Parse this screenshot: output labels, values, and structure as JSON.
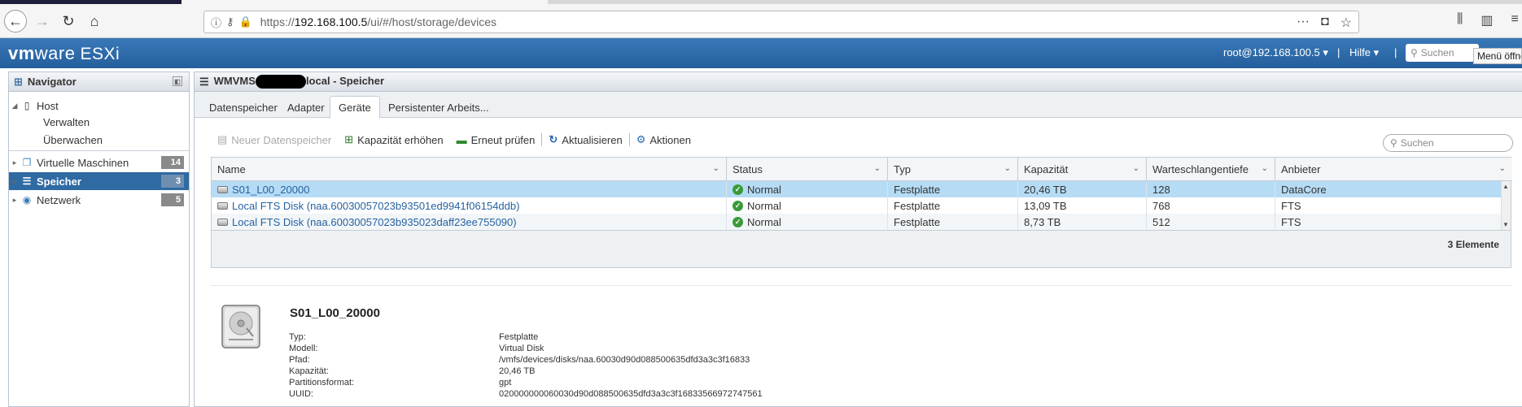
{
  "browser": {
    "url_prefix": "https://",
    "url_host": "192.168.100.5",
    "url_path": "/ui/#/host/storage/devices"
  },
  "header": {
    "logo_vm": "vm",
    "logo_ware": "ware",
    "logo_product": "ESXi",
    "user": "root@192.168.100.5 ▾",
    "separator": "|",
    "help": "Hilfe ▾",
    "search_placeholder": "Suchen",
    "tooltip": "Menü öffnen"
  },
  "navigator": {
    "title": "Navigator",
    "items": [
      {
        "label": "Host"
      },
      {
        "label": "Verwalten"
      },
      {
        "label": "Überwachen"
      },
      {
        "label": "Virtuelle Maschinen",
        "count": "14"
      },
      {
        "label": "Speicher",
        "count": "3"
      },
      {
        "label": "Netzwerk",
        "count": "5"
      }
    ]
  },
  "main": {
    "title_prefix": "WMVMS",
    "title_suffix": "local - Speicher",
    "tabs": [
      "Datenspeicher",
      "Adapter",
      "Geräte",
      "Persistenter Arbeits..."
    ],
    "actions": {
      "new_datastore": "Neuer Datenspeicher",
      "increase_capacity": "Kapazität erhöhen",
      "rescan": "Erneut prüfen",
      "refresh": "Aktualisieren",
      "actions": "Aktionen"
    },
    "search_placeholder": "Suchen"
  },
  "grid": {
    "columns": [
      "Name",
      "Status",
      "Typ",
      "Kapazität",
      "Warteschlangentiefe",
      "Anbieter"
    ],
    "rows": [
      {
        "name": "S01_L00_20000",
        "status": "Normal",
        "type": "Festplatte",
        "capacity": "20,46 TB",
        "queue": "128",
        "vendor": "DataCore"
      },
      {
        "name": "Local FTS Disk (naa.60030057023b93501ed9941f06154ddb)",
        "status": "Normal",
        "type": "Festplatte",
        "capacity": "13,09 TB",
        "queue": "768",
        "vendor": "FTS"
      },
      {
        "name": "Local FTS Disk (naa.60030057023b935023daff23ee755090)",
        "status": "Normal",
        "type": "Festplatte",
        "capacity": "8,73 TB",
        "queue": "512",
        "vendor": "FTS"
      }
    ],
    "count_label": "3 Elemente"
  },
  "details": {
    "title": "S01_L00_20000",
    "fields": [
      {
        "label": "Typ:",
        "value": "Festplatte"
      },
      {
        "label": "Modell:",
        "value": "Virtual Disk"
      },
      {
        "label": "Pfad:",
        "value": "/vmfs/devices/disks/naa.60030d90d088500635dfd3a3c3f16833"
      },
      {
        "label": "Kapazität:",
        "value": "20,46 TB"
      },
      {
        "label": "Partitionsformat:",
        "value": "gpt"
      },
      {
        "label": "UUID:",
        "value": "020000000060030d90d088500635dfd3a3c3f16833566972747561"
      }
    ]
  },
  "colors": {
    "header_blue": "#2f6aa3",
    "selection": "#b6dcf5",
    "link": "#2662a0",
    "status_ok": "#3a9a3a"
  }
}
